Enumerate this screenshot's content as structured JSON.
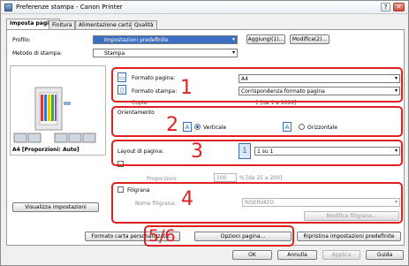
{
  "window": {
    "title": "Preferenze stampa - Canon Printer",
    "help_label": "?",
    "close_label": "×"
  },
  "tabs": [
    {
      "label": "Imposta pagina"
    },
    {
      "label": "Finitura"
    },
    {
      "label": "Alimentazione carta"
    },
    {
      "label": "Qualità"
    }
  ],
  "top": {
    "profile_label": "Profilo:",
    "profile_value": "Impostazioni predefinite",
    "add_button": "Aggiungi(1)...",
    "edit_button": "Modifica(2)...",
    "output_label": "Metodo di stampa:",
    "output_value": "Stampa"
  },
  "preview": {
    "caption": "A4 [Proporzioni: Auto]",
    "view_settings_button": "Visualizza impostazioni"
  },
  "section1": {
    "page_size_label": "Formato pagina:",
    "page_size_value": "A4",
    "output_size_label": "Formato stampa:",
    "output_size_value": "Corrispondenza formato pagina",
    "copies_label": "Copie:",
    "copies_value": "1  [da 1 a 9999]",
    "number": "1"
  },
  "section2": {
    "orientation_label": "Orientamento",
    "portrait_label": "Verticale",
    "landscape_label": "Orizzontale",
    "number": "2"
  },
  "section3": {
    "layout_label": "Layout di pagina:",
    "layout_value": "1 su 1",
    "layout_icon": "1",
    "scaling_label": "Proporzioni:",
    "scaling_value": "100",
    "scaling_range": "% [da 25 a 200]",
    "number": "3"
  },
  "section4": {
    "watermark_label": "Filigrana",
    "watermark_name_label": "Nome filigrana:",
    "watermark_value": "RISERVATO",
    "edit_watermark_button": "Modifica filigrana...",
    "number": "4"
  },
  "bottom": {
    "custom_paper_button": "Formato carta personalizzato...",
    "page_options_button": "Opzioni pagina...",
    "restore_defaults_button": "Ripristina impostazioni predefinite",
    "number": "5/6"
  },
  "footer": {
    "ok": "OK",
    "cancel": "Annulla",
    "apply": "Applica",
    "help": "Guida"
  },
  "colors": {
    "annotation": "#e02020",
    "selection": "#3b6fc6"
  }
}
